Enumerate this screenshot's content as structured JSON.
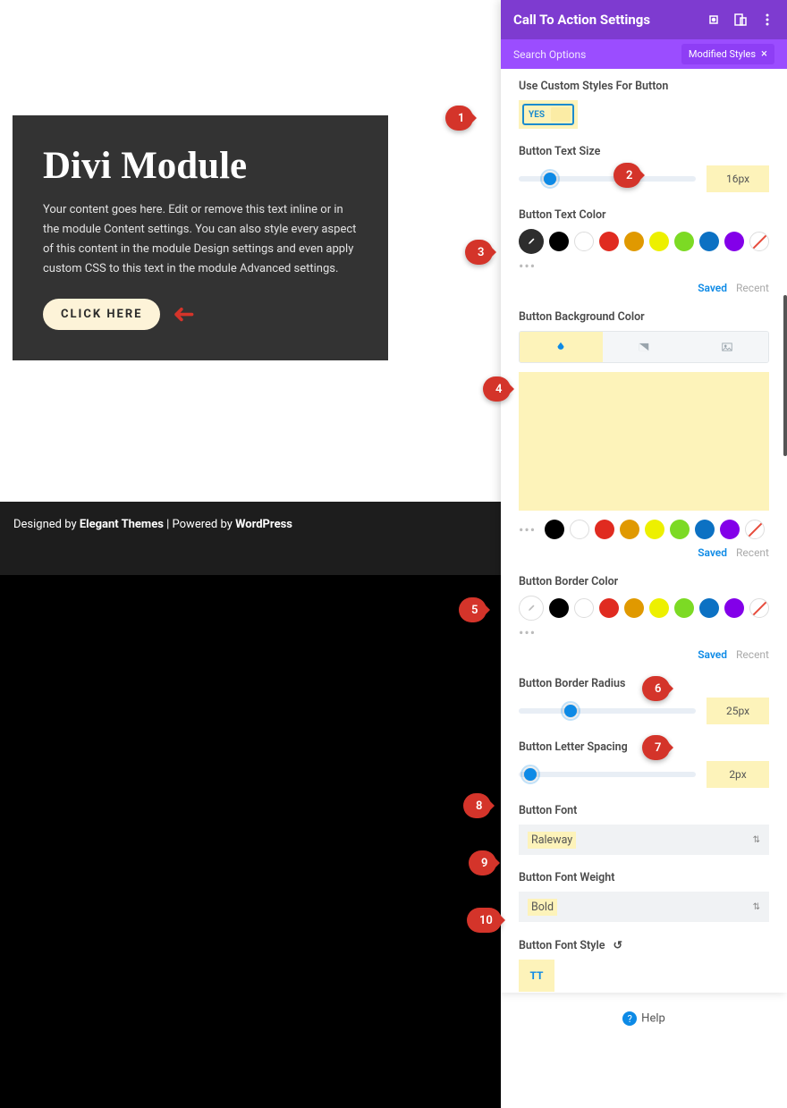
{
  "module": {
    "title": "Divi Module",
    "body": "Your content goes here. Edit or remove this text inline or in the module Content settings. You can also style every aspect of this content in the module Design settings and even apply custom CSS to this text in the module Advanced settings.",
    "button": "CLICK HERE"
  },
  "footer": {
    "prefix": "Designed by ",
    "brand": "Elegant Themes",
    "sep": " | Powered by ",
    "platform": "WordPress"
  },
  "panel": {
    "title": "Call To Action Settings",
    "search_placeholder": "Search Options",
    "modified_label": "Modified Styles"
  },
  "fields": {
    "custom_styles": {
      "label": "Use Custom Styles For Button",
      "value": "YES"
    },
    "text_size": {
      "label": "Button Text Size",
      "value": "16px",
      "thumb_pct": 14
    },
    "text_color": {
      "label": "Button Text Color"
    },
    "bg_color": {
      "label": "Button Background Color"
    },
    "border_color": {
      "label": "Button Border Color"
    },
    "border_radius": {
      "label": "Button Border Radius",
      "value": "25px",
      "thumb_pct": 26
    },
    "letter_spacing": {
      "label": "Button Letter Spacing",
      "value": "2px",
      "thumb_pct": 3
    },
    "font": {
      "label": "Button Font",
      "value": "Raleway"
    },
    "font_weight": {
      "label": "Button Font Weight",
      "value": "Bold"
    },
    "font_style": {
      "label": "Button Font Style",
      "value": "TT"
    }
  },
  "palette": {
    "colors": [
      "#000000",
      "#ffffff",
      "#e02b20",
      "#e09900",
      "#edf000",
      "#7cda24",
      "#0c71c3",
      "#8300e9"
    ]
  },
  "saved_recent": {
    "saved": "Saved",
    "recent": "Recent"
  },
  "help": "Help",
  "callouts": {
    "c1": "1",
    "c2": "2",
    "c3": "3",
    "c4": "4",
    "c5": "5",
    "c6": "6",
    "c7": "7",
    "c8": "8",
    "c9": "9",
    "c10": "10"
  }
}
